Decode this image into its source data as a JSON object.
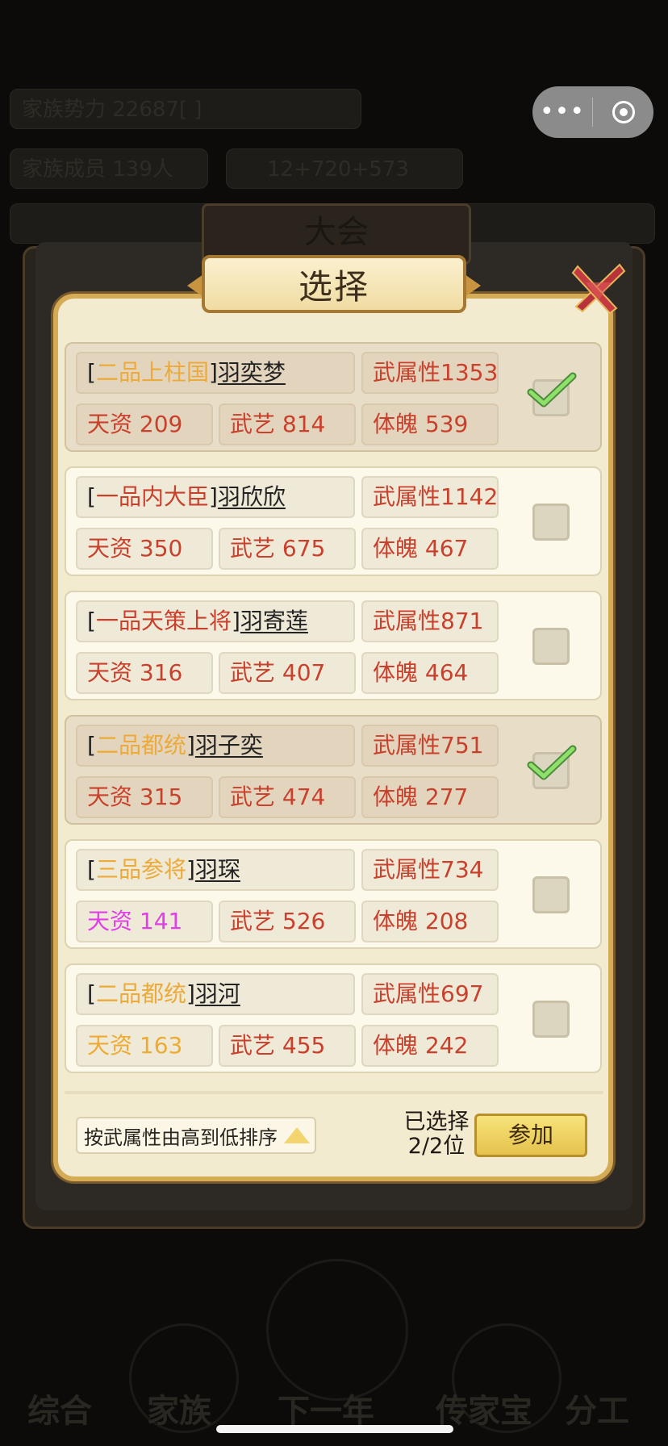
{
  "background": {
    "row1": "家族势力  22687[    ]",
    "row2": "家族成员  139人",
    "row3": "12+720+573",
    "plaque": "大会",
    "nav": [
      "综合",
      "家族",
      "下一年",
      "传家宝",
      "分工"
    ]
  },
  "capsule": {
    "more": "•••"
  },
  "dialog": {
    "title": "选择"
  },
  "candidates": [
    {
      "rank": "二品上柱国",
      "name": "羽奕梦",
      "attr": "武属性1353",
      "tianzi": "天资 209",
      "wuyi": "武艺 814",
      "tipo": "体魄 539",
      "selected": true
    },
    {
      "rank": "一品内大臣",
      "name": "羽欣欣",
      "attr": "武属性1142",
      "tianzi": "天资 350",
      "wuyi": "武艺 675",
      "tipo": "体魄 467",
      "selected": false
    },
    {
      "rank": "一品天策上将",
      "name": "羽寄莲",
      "attr": "武属性871",
      "tianzi": "天资 316",
      "wuyi": "武艺 407",
      "tipo": "体魄 464",
      "selected": false
    },
    {
      "rank": "二品都统",
      "name": "羽子奕",
      "attr": "武属性751",
      "tianzi": "天资 315",
      "wuyi": "武艺 474",
      "tipo": "体魄 277",
      "selected": true
    },
    {
      "rank": "三品参将",
      "name": "羽琛",
      "attr": "武属性734",
      "tianzi": "天资 141",
      "wuyi": "武艺 526",
      "tipo": "体魄 208",
      "selected": false
    },
    {
      "rank": "二品都统",
      "name": "羽河",
      "attr": "武属性697",
      "tianzi": "天资 163",
      "wuyi": "武艺 455",
      "tipo": "体魄 242",
      "selected": false
    }
  ],
  "footer": {
    "sort_label": "按武属性由高到低排序",
    "selected_line1": "已选择",
    "selected_line2": "2/2位",
    "join_label": "参加"
  },
  "colors": {
    "rank_gold": "#ecaa3a",
    "rank_red": "#c9402c",
    "stat_red": "#c9402c",
    "stat_purple": "#e03ee6",
    "stat_orange": "#eeab33",
    "check_green": "#7fd45c"
  }
}
